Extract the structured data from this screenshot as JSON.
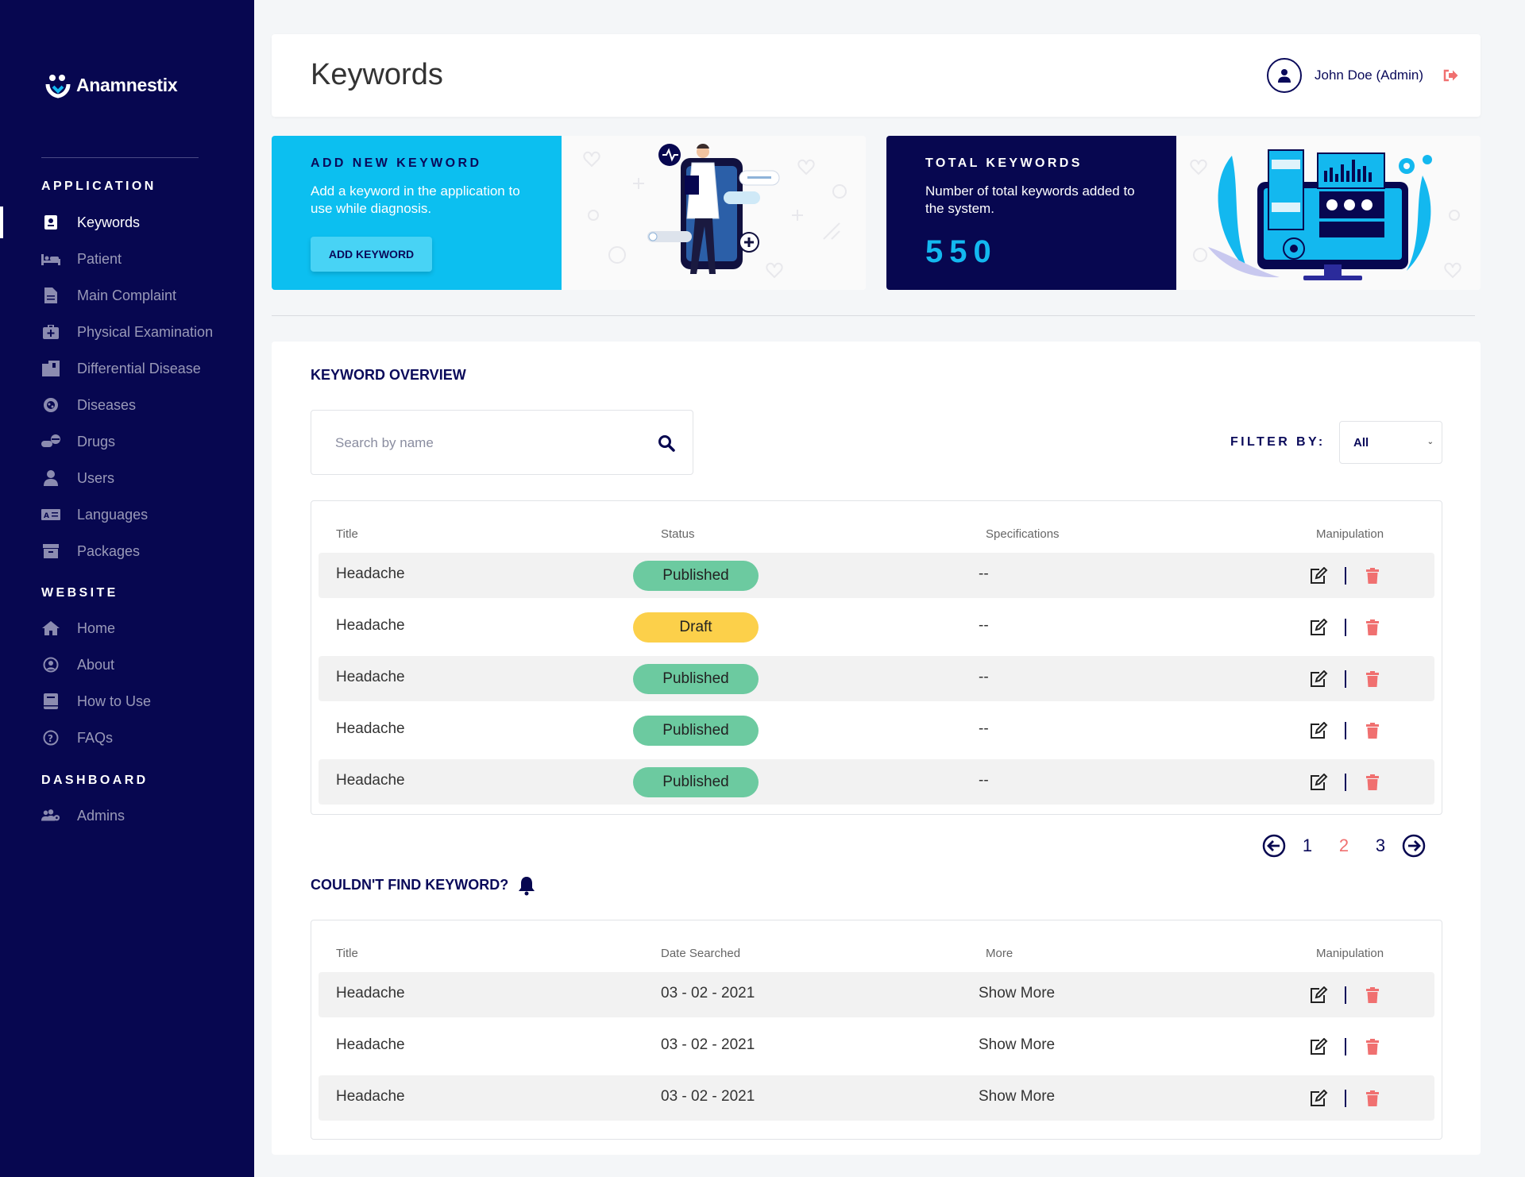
{
  "brand": {
    "name": "Anamnestix"
  },
  "sidebar": {
    "sections": {
      "application": "APPLICATION",
      "website": "WEBSITE",
      "dashboard": "DASHBOARD"
    },
    "application_items": [
      {
        "label": "Keywords",
        "icon": "keyword-icon",
        "active": true
      },
      {
        "label": "Patient",
        "icon": "bed-icon"
      },
      {
        "label": "Main Complaint",
        "icon": "document-icon"
      },
      {
        "label": "Physical Examination",
        "icon": "briefcase-medical-icon"
      },
      {
        "label": "Differential Disease",
        "icon": "hospital-icon"
      },
      {
        "label": "Diseases",
        "icon": "virus-icon"
      },
      {
        "label": "Drugs",
        "icon": "pills-icon"
      },
      {
        "label": "Users",
        "icon": "user-icon"
      },
      {
        "label": "Languages",
        "icon": "language-icon"
      },
      {
        "label": "Packages",
        "icon": "box-icon"
      }
    ],
    "website_items": [
      {
        "label": "Home",
        "icon": "home-icon"
      },
      {
        "label": "About",
        "icon": "user-circle-icon"
      },
      {
        "label": "How to Use",
        "icon": "book-icon"
      },
      {
        "label": "FAQs",
        "icon": "question-icon"
      }
    ],
    "dashboard_items": [
      {
        "label": "Admins",
        "icon": "users-gear-icon"
      }
    ]
  },
  "header": {
    "title": "Keywords",
    "user_name": "John Doe (Admin)"
  },
  "cards": {
    "add": {
      "heading": "ADD NEW KEYWORD",
      "description": "Add a keyword in the application to use while diagnosis.",
      "button": "ADD KEYWORD"
    },
    "total": {
      "heading": "TOTAL KEYWORDS",
      "description": "Number of total keywords added to the system.",
      "value": "550"
    }
  },
  "overview": {
    "title": "KEYWORD OVERVIEW",
    "search_placeholder": "Search by name",
    "filter_label": "FILTER BY:",
    "filter_value": "All",
    "columns": [
      "Title",
      "Status",
      "Specifications",
      "Manipulation"
    ],
    "rows": [
      {
        "title": "Headache",
        "status": "Published",
        "spec": "--"
      },
      {
        "title": "Headache",
        "status": "Draft",
        "spec": "--"
      },
      {
        "title": "Headache",
        "status": "Published",
        "spec": "--"
      },
      {
        "title": "Headache",
        "status": "Published",
        "spec": "--"
      },
      {
        "title": "Headache",
        "status": "Published",
        "spec": "--"
      }
    ],
    "pagination": {
      "pages": [
        "1",
        "2",
        "3"
      ],
      "current": "2"
    }
  },
  "missing": {
    "title": "COULDN'T FIND KEYWORD?",
    "columns": [
      "Title",
      "Date Searched",
      "More",
      "Manipulation"
    ],
    "rows": [
      {
        "title": "Headache",
        "date": "03 - 02 - 2021",
        "more": "Show More"
      },
      {
        "title": "Headache",
        "date": "03 - 02 - 2021",
        "more": "Show More"
      },
      {
        "title": "Headache",
        "date": "03 - 02 - 2021",
        "more": "Show More"
      }
    ]
  },
  "colors": {
    "sidebar": "#070750",
    "accent_cyan": "#0cbff0",
    "published": "#6ccaa0",
    "draft": "#fcd04a",
    "delete": "#f07070"
  }
}
